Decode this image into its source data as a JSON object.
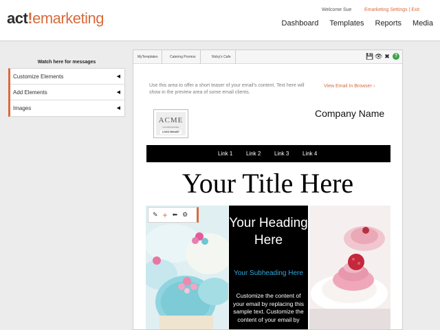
{
  "header": {
    "logo": {
      "act": "act",
      "bang": "!",
      "rest": "emarketing"
    },
    "welcome": "Welcome Sue",
    "toplinks": "Emarketing Settings | Exit",
    "nav": [
      "Dashboard",
      "Templates",
      "Reports",
      "Media"
    ]
  },
  "sidebar": {
    "title": "Watch here for messages",
    "items": [
      "Customize Elements",
      "Add Elements",
      "Images"
    ]
  },
  "editor": {
    "breadcrumbs": [
      "MyTemplates",
      "Catering Promos",
      "Nicky's Cafe"
    ],
    "tool_icons": [
      "save-icon",
      "preview-eye-icon",
      "close-icon",
      "help-icon"
    ],
    "teaser": "Use this area to offer a short teaser of your email's content. Text here will show in the preview area of some email clients.",
    "view_in_browser": "View Email In Browser ›",
    "logo_placeholder": {
      "name": "ACME",
      "sub": "INCORPORATED",
      "badge": "LOGO 500x657"
    },
    "company_name": "Company Name",
    "links": [
      "Link 1",
      "Link 2",
      "Link 3",
      "Link 4"
    ],
    "title": "Your Title Here",
    "column": {
      "heading": "Your Heading Here",
      "subheading": "Your Subheading Here",
      "body": "Customize the content of your email by replacing this sample text. Customize the content of your email by"
    }
  },
  "colors": {
    "accent": "#d96a3b",
    "subheading": "#31a7d9",
    "help": "#3aa24a"
  }
}
